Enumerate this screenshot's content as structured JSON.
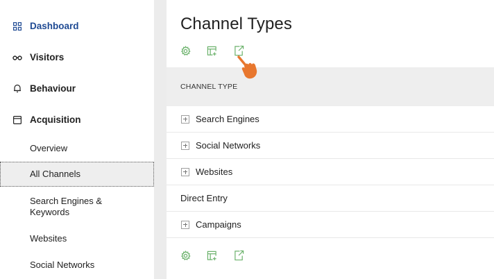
{
  "sidebar": {
    "items": [
      {
        "label": "Dashboard",
        "icon": "dashboard-icon",
        "active": true
      },
      {
        "label": "Visitors",
        "icon": "glasses-icon"
      },
      {
        "label": "Behaviour",
        "icon": "bell-icon"
      },
      {
        "label": "Acquisition",
        "icon": "window-icon"
      }
    ],
    "subitems": [
      {
        "label": "Overview"
      },
      {
        "label": "All Channels",
        "selected": true
      },
      {
        "label": "Search Engines & Keywords"
      },
      {
        "label": "Websites"
      },
      {
        "label": "Social Networks"
      }
    ]
  },
  "main": {
    "title": "Channel Types",
    "toolbar": [
      "settings-icon",
      "table-add-icon",
      "export-icon"
    ],
    "column_header": "CHANNEL TYPE",
    "rows": [
      {
        "label": "Search Engines",
        "expandable": true
      },
      {
        "label": "Social Networks",
        "expandable": true
      },
      {
        "label": "Websites",
        "expandable": true
      },
      {
        "label": "Direct Entry",
        "expandable": false
      },
      {
        "label": "Campaigns",
        "expandable": true
      }
    ]
  },
  "colors": {
    "accent_nav": "#1f4a93",
    "icon_green": "#6cb26c",
    "cursor_orange": "#e8772e"
  }
}
